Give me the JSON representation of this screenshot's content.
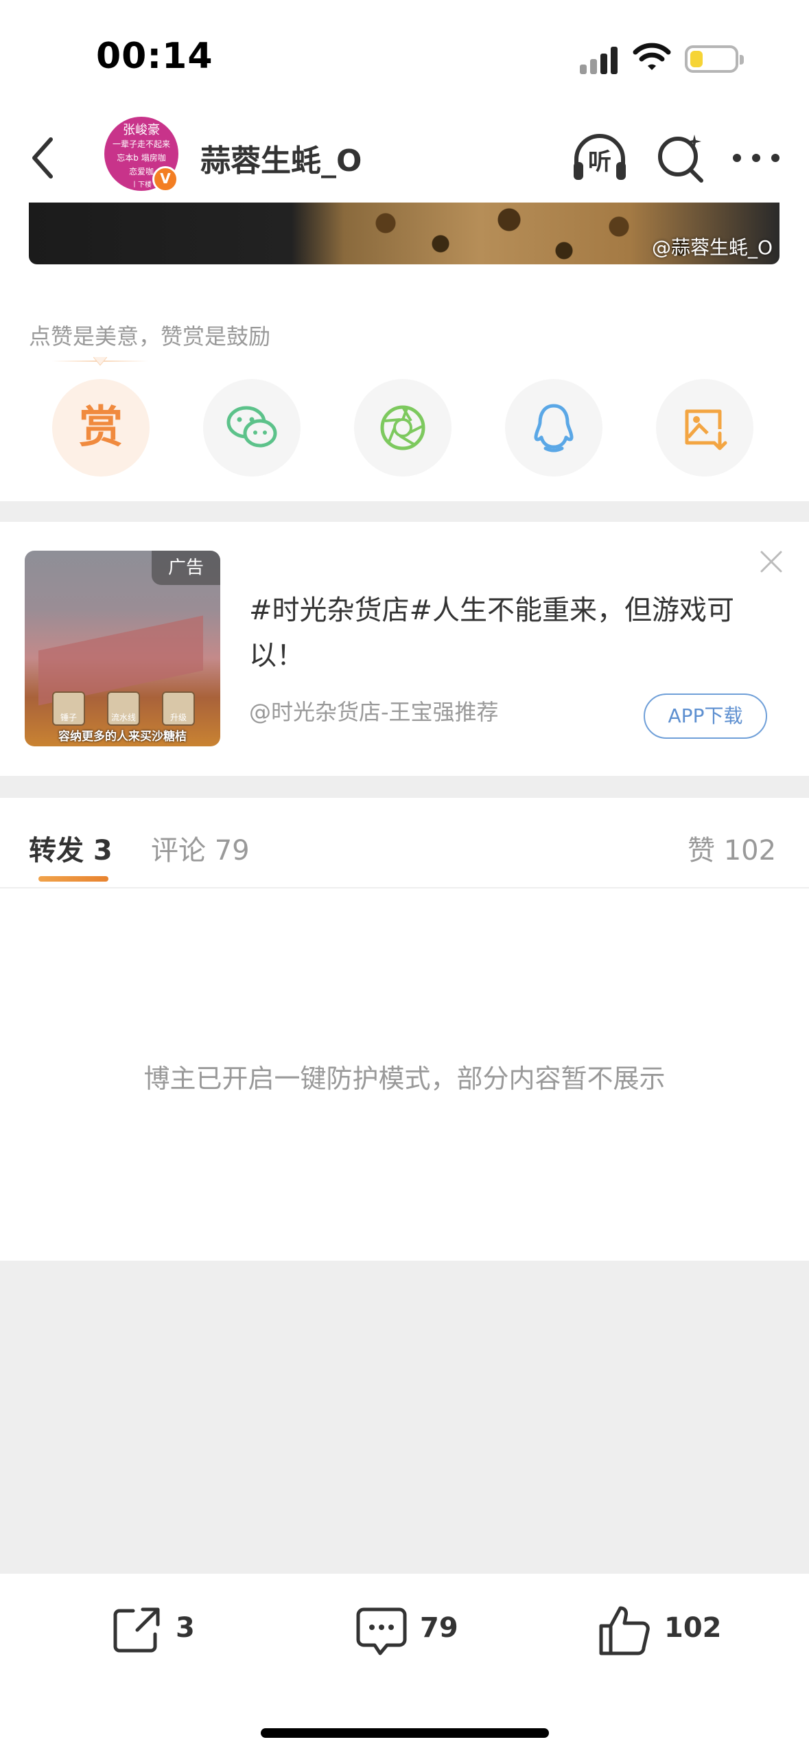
{
  "status_bar": {
    "time": "00:14"
  },
  "header": {
    "username": "蒜蓉生蚝_O",
    "avatar_text": [
      "张峻豪",
      "一辈子走不起来",
      "忘本b  塌房咖",
      "恋爱咖",
      "丨下楼"
    ],
    "verified_label": "V",
    "listen_label": "听"
  },
  "photo": {
    "watermark": "@蒜蓉生蚝_O"
  },
  "reward": {
    "tip": "点赞是美意，赞赏是鼓励",
    "reward_char": "赏"
  },
  "ad": {
    "tag": "广告",
    "title": "#时光杂货店#人生不能重来，但游戏可以！",
    "source": "@时光杂货店-王宝强推荐",
    "button": "APP下载",
    "tools": [
      "锤子",
      "流水线",
      "升级"
    ],
    "caption": "容纳更多的人来买沙糖桔"
  },
  "tabs": {
    "repost": "转发 3",
    "comments": "评论 79",
    "likes": "赞 102"
  },
  "message": "博主已开启一键防护模式，部分内容暂不展示",
  "bottom_bar": {
    "repost_count": "3",
    "comment_count": "79",
    "like_count": "102"
  },
  "colors": {
    "accent": "#e8832f",
    "wechat": "#5cc28a",
    "moments": "#7dc95e",
    "qq": "#5aa7e6",
    "save": "#f3a542"
  }
}
